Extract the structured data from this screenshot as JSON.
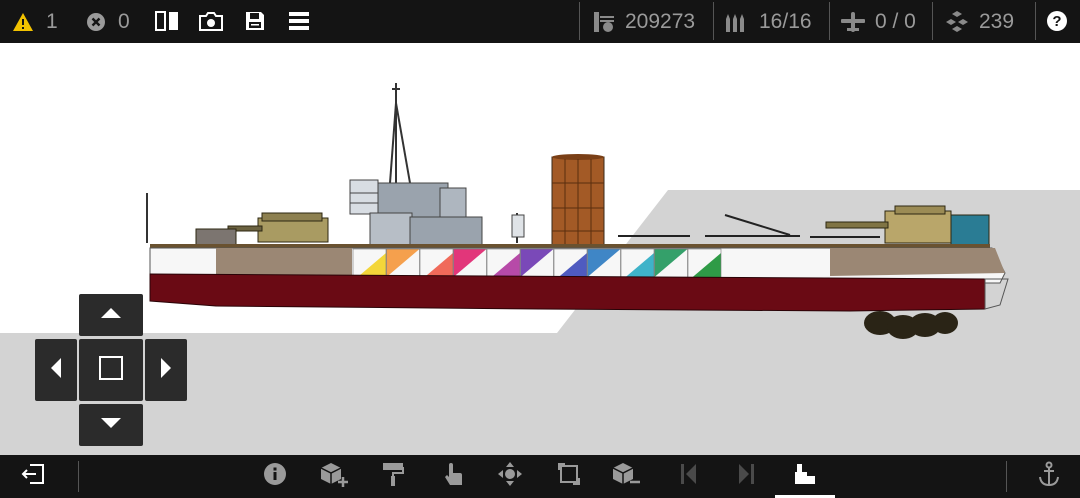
{
  "toolbar": {
    "warnings_count": "1",
    "errors_count": "0",
    "cost": "209273",
    "ammo": "16/16",
    "aircraft": "0 / 0",
    "parts": "239"
  },
  "colors": {
    "bar_bg": "#141414",
    "warning": "#f2c200",
    "icon_gray": "#9a9a9a",
    "ground": "#d3d3d3",
    "hull_red": "#6a0a14",
    "active_underline": "#ffffff"
  },
  "icons": {
    "top": [
      "warning-icon",
      "error-icon",
      "mirror-icon",
      "camera-icon",
      "save-icon",
      "menu-icon",
      "cost-icon",
      "ammo-icon",
      "aircraft-icon",
      "parts-icon",
      "help-icon"
    ],
    "bottom": [
      "exit-icon",
      "info-icon",
      "add-part-icon",
      "paint-roller-icon",
      "touch-icon",
      "move-icon",
      "resize-icon",
      "remove-part-icon",
      "previous-icon",
      "next-icon",
      "stats-icon",
      "anchor-icon"
    ]
  },
  "stripe_colors": [
    "#f3d63a",
    "#f5a04d",
    "#f06a5a",
    "#e2367a",
    "#b74aa8",
    "#7a49b8",
    "#4f5bc0",
    "#3f86c6",
    "#3fb3c9",
    "#34a06a",
    "#2f9b47"
  ]
}
